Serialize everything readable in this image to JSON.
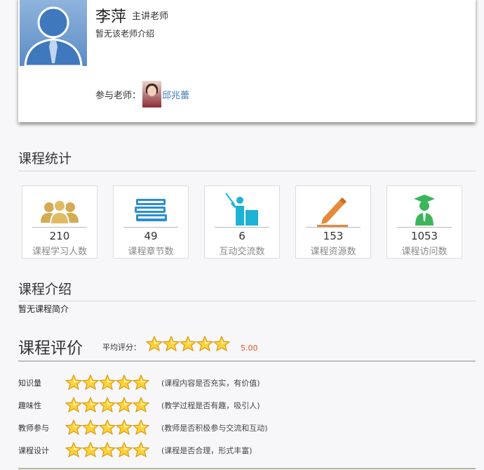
{
  "teacher": {
    "name": "李萍",
    "role": "主讲老师",
    "intro": "暂无该老师介绍",
    "participants_label": "参与老师：",
    "participants": [
      {
        "name": "邱兆蕾"
      }
    ]
  },
  "stats": {
    "title": "课程统计",
    "items": [
      {
        "value": "210",
        "label": "课程学习人数",
        "icon": "people-icon",
        "color": "#d4ab52"
      },
      {
        "value": "49",
        "label": "课程章节数",
        "icon": "books-icon",
        "color": "#2b8fd0"
      },
      {
        "value": "6",
        "label": "互动交流数",
        "icon": "teacher-presenting-icon",
        "color": "#1cb3d5"
      },
      {
        "value": "153",
        "label": "课程资源数",
        "icon": "pencil-icon",
        "color": "#e58a3a"
      },
      {
        "value": "1053",
        "label": "课程访问数",
        "icon": "graduate-icon",
        "color": "#3cb55c"
      }
    ]
  },
  "intro": {
    "title": "课程介绍",
    "text": "暂无课程简介"
  },
  "evaluation": {
    "title": "课程评价",
    "avg_label": "平均评分：",
    "avg_stars": 5,
    "avg_score": "5.00",
    "rows": [
      {
        "label": "知识量",
        "stars": 5,
        "desc": "(课程内容是否充实，有价值)"
      },
      {
        "label": "趣味性",
        "stars": 5,
        "desc": "(教学过程是否有趣，吸引人)"
      },
      {
        "label": "教师参与",
        "stars": 5,
        "desc": "(教师是否积极参与交流和互动)"
      },
      {
        "label": "课程设计",
        "stars": 5,
        "desc": "(课程是否合理，形式丰富)"
      }
    ]
  }
}
